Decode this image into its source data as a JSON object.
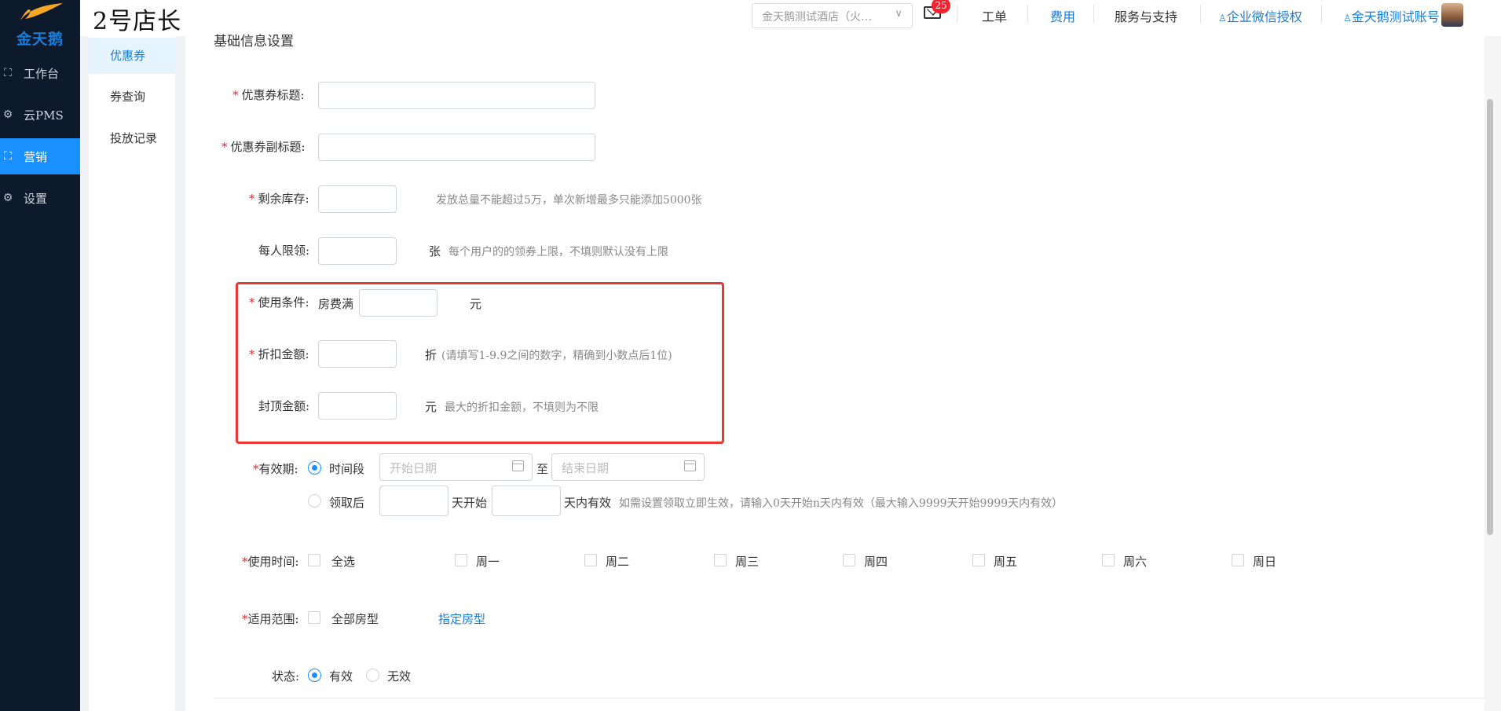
{
  "app": {
    "logo_text": "金天鹅",
    "brand": "2号店长"
  },
  "sidebar": {
    "items": [
      {
        "label": "工作台",
        "icon": "scan-icon"
      },
      {
        "label": "云PMS",
        "icon": "gear-icon"
      },
      {
        "label": "营销",
        "icon": "scan-icon",
        "active": true
      },
      {
        "label": "设置",
        "icon": "gear-icon"
      }
    ]
  },
  "header": {
    "hotel_select": "金天鹅测试酒店（火…",
    "badge_count": "25",
    "links": [
      "工单",
      "费用",
      "服务与支持"
    ],
    "wechat_auth": "企业微信授权",
    "account": "金天鹅测试账号"
  },
  "subnav": {
    "items": [
      "优惠券",
      "券查询",
      "投放记录"
    ]
  },
  "form": {
    "section_title": "基础信息设置",
    "coupon_title_label": "优惠券标题:",
    "coupon_subtitle_label": "优惠券副标题:",
    "stock_label": "剩余库存:",
    "stock_hint": "发放总量不能超过5万，单次新增最多只能添加5000张",
    "per_user_label": "每人限领:",
    "per_user_unit": "张",
    "per_user_hint": "每个用户的的领券上限，不填则默认没有上限",
    "condition_label": "使用条件:",
    "condition_prefix": "房费满",
    "condition_unit": "元",
    "discount_label": "折扣金额:",
    "discount_unit": "折",
    "discount_hint": "(请填写1-9.9之间的数字，精确到小数点后1位)",
    "cap_label": "封顶金额:",
    "cap_unit": "元",
    "cap_hint": "最大的折扣金额，不填则为不限",
    "validity_label": "有效期:",
    "period_option": "时间段",
    "start_placeholder": "开始日期",
    "to_text": "至",
    "end_placeholder": "结束日期",
    "after_option": "领取后",
    "day_start": "天开始",
    "day_valid": "天内有效",
    "after_hint": "如需设置领取立即生效，请输入0天开始n天内有效（最大输入9999天开始9999天内有效）",
    "use_time_label": "使用时间:",
    "days": [
      "全选",
      "周一",
      "周二",
      "周三",
      "周四",
      "周五",
      "周六",
      "周日"
    ],
    "scope_label": "适用范围:",
    "all_room": "全部房型",
    "specify_room": "指定房型",
    "status_label": "状态:",
    "status_valid": "有效",
    "status_invalid": "无效"
  }
}
